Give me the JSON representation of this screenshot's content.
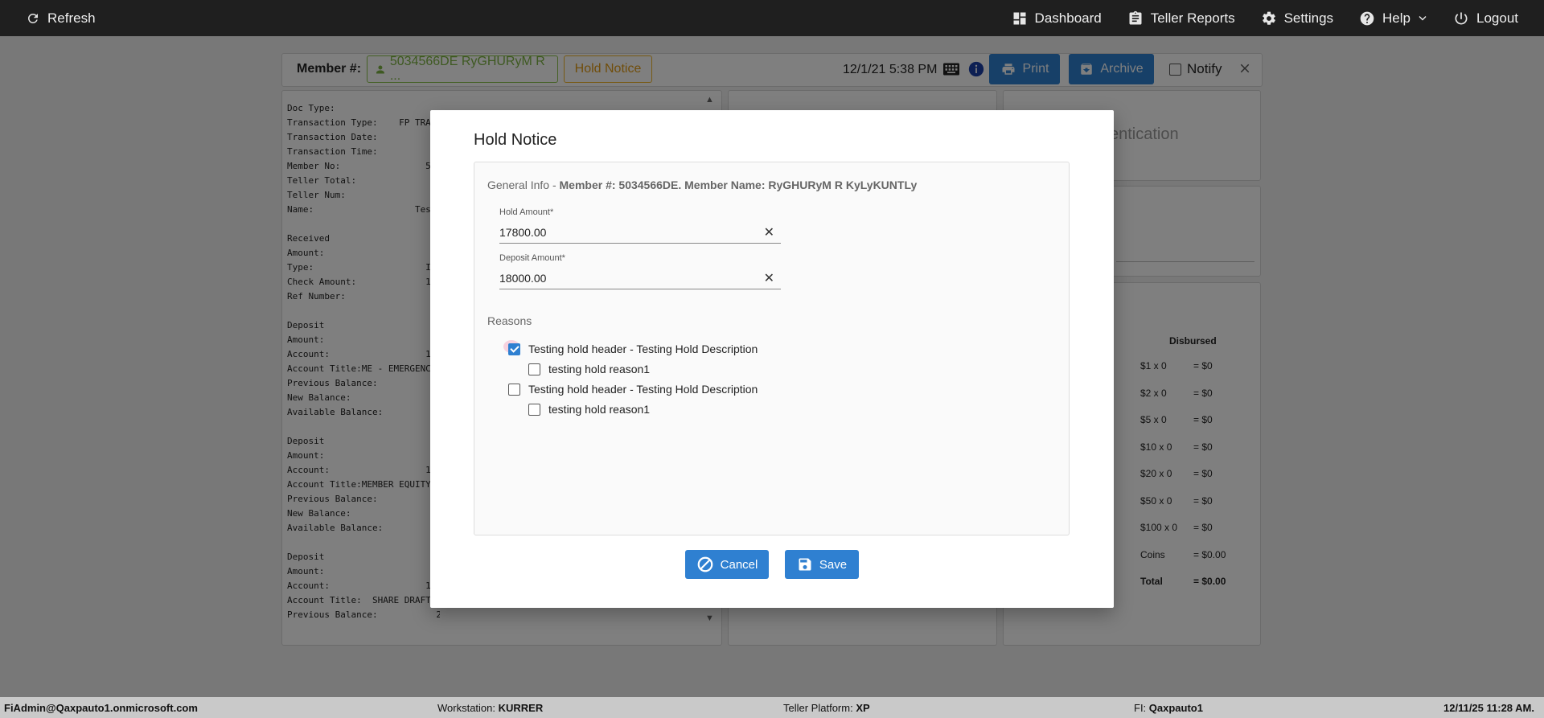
{
  "topbar": {
    "refresh": "Refresh",
    "dashboard": "Dashboard",
    "teller_reports": "Teller Reports",
    "settings": "Settings",
    "help": "Help",
    "logout": "Logout"
  },
  "toolbar": {
    "member_label": "Member #:",
    "member_value": "5034566DE RyGHURyM R ...",
    "hold_notice": "Hold Notice",
    "datetime": "12/1/21 5:38 PM",
    "print": "Print",
    "archive": "Archive",
    "notify": "Notify"
  },
  "receipt": {
    "text": "Doc Type:\nTransaction Type:    FP TRA\nTransaction Date:\nTransaction Time:\nMember No:                5\nTeller Total:\nTeller Num:\nName:                   Tes\n\nReceived\nAmount:\nType:                     IN\nCheck Amount:             18\nRef Number:\n\nDeposit\nAmount:\nAccount:                  1\nAccount Title:ME - EMERGENC\nPrevious Balance:\nNew Balance:\nAvailable Balance:\n\nDeposit\nAmount:\nAccount:                  1\nAccount Title:MEMBER EQUITY\nPrevious Balance:\nNew Balance:\nAvailable Balance:\n\nDeposit\nAmount:\nAccount:                  1\nAccount Title:  SHARE DRAFT ACCOUNT\nPrevious Balance:           219.07"
  },
  "right_panels": {
    "auth_text": "entication",
    "disbursed_header": "Disbursed",
    "rows": [
      {
        "denom": "$1 x 0",
        "value": "= $0"
      },
      {
        "denom": "$2 x 0",
        "value": "= $0"
      },
      {
        "denom": "$5 x 0",
        "value": "= $0"
      },
      {
        "denom": "$10 x 0",
        "value": "= $0"
      },
      {
        "denom": "$20 x 0",
        "value": "= $0"
      },
      {
        "denom": "$50 x 0",
        "value": "= $0"
      },
      {
        "denom": "$100 x 0",
        "value": "= $0"
      },
      {
        "denom": "Coins",
        "value": "= $0.00"
      },
      {
        "denom": "Total",
        "value": "= $0.00"
      }
    ]
  },
  "modal": {
    "title": "Hold Notice",
    "general_prefix": "General Info - ",
    "general_bold": "Member #: 5034566DE. Member Name: RyGHURyM R KyLyKUNTLy",
    "hold_amount_label": "Hold Amount*",
    "hold_amount_value": "17800.00",
    "deposit_amount_label": "Deposit Amount*",
    "deposit_amount_value": "18000.00",
    "reasons_label": "Reasons",
    "reasons": [
      {
        "label": "Testing hold header - Testing Hold Description",
        "checked": true
      },
      {
        "label": "testing hold reason1",
        "checked": false
      },
      {
        "label": "Testing hold header - Testing Hold Description",
        "checked": false
      },
      {
        "label": "testing hold reason1",
        "checked": false
      }
    ],
    "cancel": "Cancel",
    "save": "Save"
  },
  "statusbar": {
    "user": "FiAdmin@Qaxpauto1.onmicrosoft.com",
    "workstation_label": "Workstation: ",
    "workstation": "KURRER",
    "platform_label": "Teller Platform: ",
    "platform": "XP",
    "fi_label": "FI: ",
    "fi": "Qaxpauto1",
    "timestamp": "12/11/25 11:28 AM."
  },
  "colors": {
    "primary": "#2f80d1",
    "member_green": "#7cb342",
    "hold_orange": "#e09a14",
    "topbar": "#1f1f1f"
  }
}
